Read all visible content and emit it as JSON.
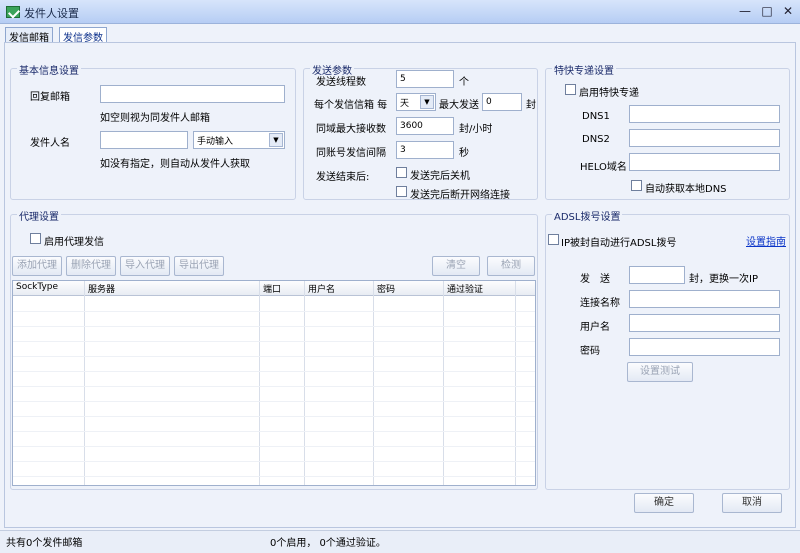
{
  "window": {
    "title": "发件人设置",
    "controls": {
      "minimize": "—",
      "maximize": "□",
      "close": "✕"
    }
  },
  "tabs": [
    {
      "label": "发信邮箱"
    },
    {
      "label": "发信参数"
    }
  ],
  "basic": {
    "title": "基本信息设置",
    "reply_label": "回复邮箱",
    "reply_value": "",
    "reply_hint": "如空则视为同发件人邮箱",
    "sender_label": "发件人名",
    "sender_value": "",
    "sender_mode": "手动输入",
    "sender_hint": "如没有指定，则自动从发件人获取"
  },
  "send": {
    "title": "发送参数",
    "threads_label": "发送线程数",
    "threads_value": "5",
    "threads_unit": "个",
    "per_mailbox_label": "每个发信信箱 每",
    "per_period": "天",
    "max_label": "最大发送",
    "max_value": "0",
    "max_unit": "封",
    "domain_label": "同域最大接收数",
    "domain_value": "3600",
    "domain_unit": "封/小时",
    "interval_label": "同账号发信间隔",
    "interval_value": "3",
    "interval_unit": "秒",
    "after_label": "发送结束后:",
    "after_opt1": "发送完后关机",
    "after_opt2": "发送完后断开网络连接"
  },
  "express": {
    "title": "特快专递设置",
    "enable_label": "启用特快专递",
    "dns1_label": "DNS1",
    "dns2_label": "DNS2",
    "helo_label": "HELO域名",
    "auto_dns_label": "自动获取本地DNS"
  },
  "proxy": {
    "title": "代理设置",
    "enable_label": "启用代理发信",
    "buttons": {
      "add": "添加代理",
      "delete": "删除代理",
      "import": "导入代理",
      "export": "导出代理",
      "clear": "清空",
      "check": "检测"
    },
    "columns": [
      "SockType",
      "服务器",
      "端口",
      "用户名",
      "密码",
      "通过验证"
    ]
  },
  "adsl": {
    "title": "ADSL拨号设置",
    "enable_label": "IP被封自动进行ADSL拨号",
    "guide_link": "设置指南",
    "send_label": "发　送",
    "send_suffix": "封，更换一次IP",
    "conn_label": "连接名称",
    "user_label": "用户名",
    "pass_label": "密码",
    "test_button": "设置测试"
  },
  "footer": {
    "ok": "确定",
    "cancel": "取消"
  },
  "status": {
    "mailbox_count": "共有0个发件邮箱",
    "proxy_status": "0个启用， 0个通过验证。"
  }
}
